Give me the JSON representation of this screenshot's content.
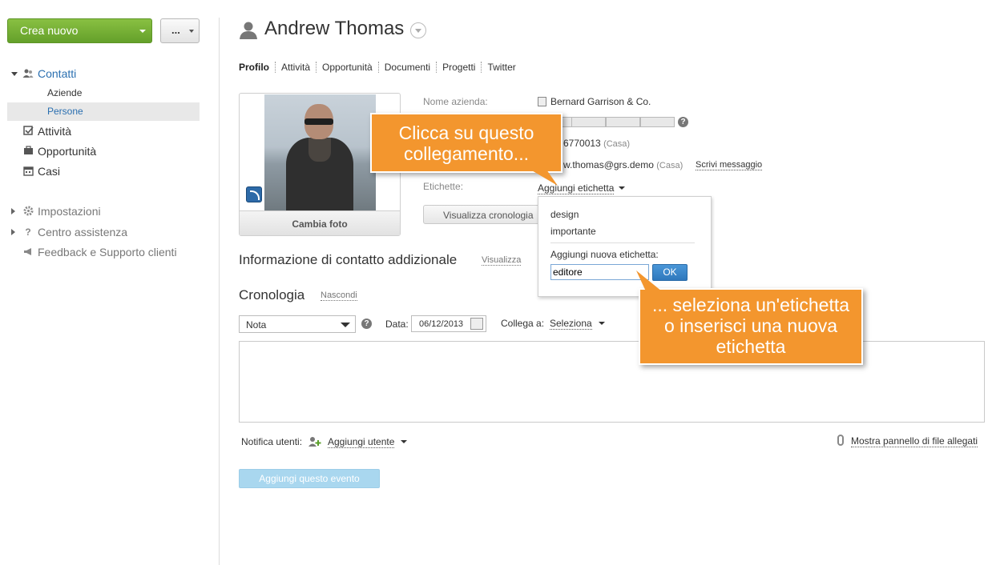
{
  "sidebar": {
    "new_button": "Crea nuovo",
    "more_button": "...",
    "nav": {
      "contacts": "Contatti",
      "companies": "Aziende",
      "people": "Persone",
      "activities": "Attività",
      "opportunities": "Opportunità",
      "cases": "Casi",
      "settings": "Impostazioni",
      "help_center": "Centro assistenza",
      "feedback": "Feedback e Supporto clienti"
    }
  },
  "header": {
    "title": "Andrew Thomas",
    "tabs": [
      "Profilo",
      "Attività",
      "Opportunità",
      "Documenti",
      "Progetti",
      "Twitter"
    ]
  },
  "photo": {
    "change_label": "Cambia foto"
  },
  "fields": {
    "company_label": "Nome azienda:",
    "company_value": "Bernard Garrison & Co.",
    "phone_value": "6770013",
    "phone_type": "(Casa)",
    "email_value": "w.thomas@grs.demo",
    "email_type": "(Casa)",
    "write_message": "Scrivi messaggio",
    "tags_label": "Etichette:",
    "history_button": "Visualizza cronologia"
  },
  "tag_dropdown": {
    "trigger": "Aggiungi etichetta",
    "options": [
      "design",
      "importante"
    ],
    "new_tag_label": "Aggiungi nuova etichetta:",
    "input_value": "editore",
    "ok_button": "OK"
  },
  "additional_info": {
    "title": "Informazione di contatto addizionale",
    "link": "Visualizza"
  },
  "timeline": {
    "title": "Cronologia",
    "hide_link": "Nascondi",
    "type_value": "Nota",
    "date_label": "Data:",
    "date_value": "06/12/2013",
    "link_label": "Collega a:",
    "link_value": "Seleziona",
    "notify_label": "Notifica utenti:",
    "add_user": "Aggiungi utente",
    "attachments_link": "Mostra pannello di file allegati",
    "add_event_button": "Aggiungi questo evento"
  },
  "callouts": {
    "first": [
      "Clicca su questo",
      "collegamento..."
    ],
    "second": [
      "... seleziona un'etichetta",
      "o inserisci una nuova",
      "etichetta"
    ]
  },
  "colors": {
    "accent_green": "#6aa52e",
    "callout_orange": "#f3962e",
    "link_blue": "#2a6fb0"
  }
}
